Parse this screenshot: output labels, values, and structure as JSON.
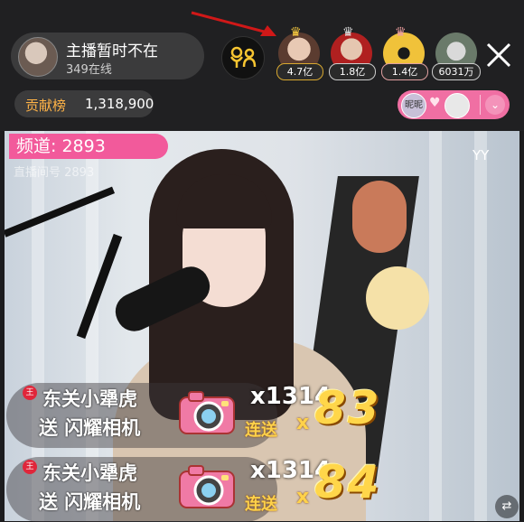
{
  "host": {
    "name": "主播暂时不在",
    "online": "349在线"
  },
  "fans": [
    {
      "value": "4.7亿",
      "icon": "crown-icon"
    },
    {
      "value": "1.8亿",
      "icon": "crown-icon"
    },
    {
      "value": "1.4亿",
      "icon": "crown-icon"
    },
    {
      "value": "6031万"
    }
  ],
  "contribution": {
    "label": "贡献榜",
    "value": "1,318,900"
  },
  "pk": {
    "avatar1_text": "昵昵"
  },
  "video": {
    "channel": "频道: 2893",
    "watermark": "YY",
    "faint_line": "直播间号 2893"
  },
  "gifts": [
    {
      "user": "东关小犟虎",
      "action": "送 闪耀相机",
      "multiplier": "x1314",
      "combo_label": "连送",
      "combo_x": "x",
      "count": "83"
    },
    {
      "user": "东关小犟虎",
      "action": "送 闪耀相机",
      "multiplier": "x1314",
      "combo_label": "连送",
      "combo_x": "x",
      "count": "84"
    }
  ],
  "colors": {
    "accent_pink": "#f25a9b",
    "gold": "#ffd64a",
    "contrib": "#ffb347"
  }
}
